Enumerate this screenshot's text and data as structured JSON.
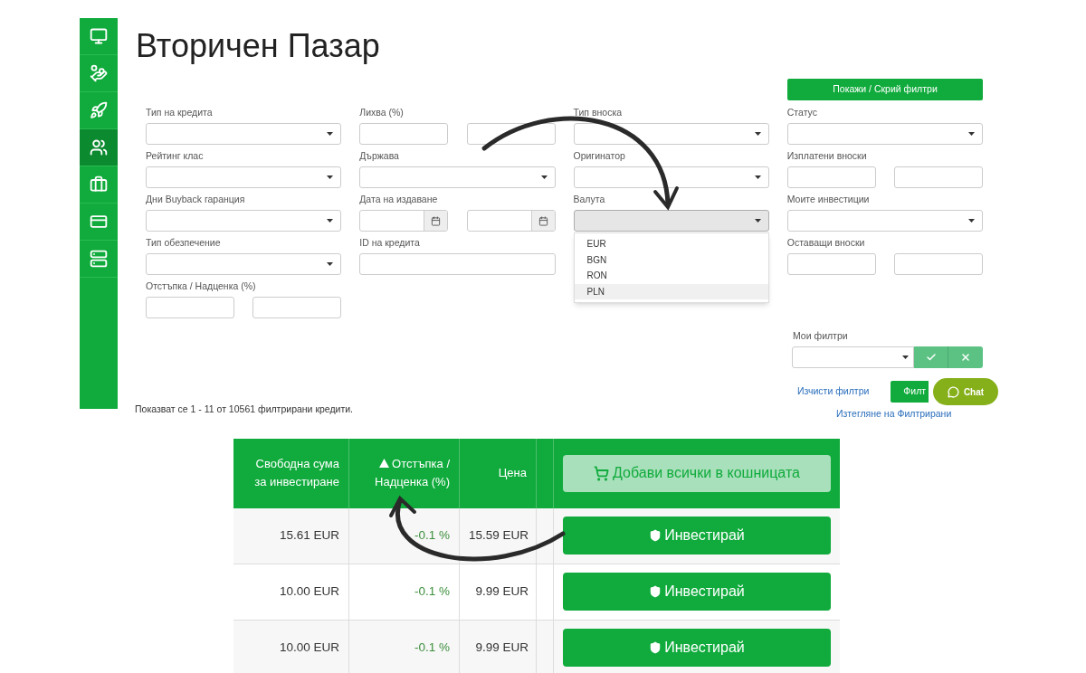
{
  "page": {
    "title": "Вторичен Пазар"
  },
  "sidebar": {
    "items": [
      {
        "selected": false
      },
      {
        "selected": false
      },
      {
        "selected": false
      },
      {
        "selected": true
      },
      {
        "selected": false
      },
      {
        "selected": false
      },
      {
        "selected": false
      }
    ]
  },
  "filters": {
    "toggle_button": "Покажи / Скрий филтри",
    "columns": [
      [
        {
          "kind": "select",
          "label": "Тип на кредита"
        },
        {
          "kind": "select",
          "label": "Рейтинг клас"
        },
        {
          "kind": "select",
          "label": "Дни Buyback гаранция"
        },
        {
          "kind": "select",
          "label": "Тип обезпечение"
        },
        {
          "kind": "range",
          "label": "Отстъпка / Надценка (%)"
        }
      ],
      [
        {
          "kind": "range",
          "label": "Лихва (%)"
        },
        {
          "kind": "select",
          "label": "Държава"
        },
        {
          "kind": "date_range",
          "label": "Дата на издаване"
        },
        {
          "kind": "input",
          "label": "ID на кредита"
        }
      ],
      [
        {
          "kind": "select",
          "label": "Тип вноска"
        },
        {
          "kind": "select",
          "label": "Оригинатор"
        },
        {
          "kind": "select",
          "label": "Валута",
          "expanded": true,
          "options": [
            {
              "label": "EUR",
              "selected": false
            },
            {
              "label": "BGN",
              "selected": false
            },
            {
              "label": "RON",
              "selected": false
            },
            {
              "label": "PLN",
              "selected": true
            }
          ]
        }
      ],
      [
        {
          "kind": "select",
          "label": "Статус"
        },
        {
          "kind": "range",
          "label": "Изплатени вноски"
        },
        {
          "kind": "select",
          "label": "Моите инвестиции"
        },
        {
          "kind": "range",
          "label": "Оставащи вноски"
        }
      ]
    ]
  },
  "my_filters": {
    "label": "Мои филтри"
  },
  "clear_link": "Изчисти филтри",
  "filter_button": "Филт",
  "download_link": "Изтегляне на Филтрирани",
  "result_text": "Показват се 1 - 11 от 10561 филтрирани кредити.",
  "chat": {
    "label": "Chat"
  },
  "table": {
    "columns": [
      {
        "label": "Свободна сума за инвестиране",
        "sorted": false
      },
      {
        "label": "Отстъпка / Надценка (%)",
        "sorted": true
      },
      {
        "label": "Цена",
        "sorted": false
      }
    ],
    "add_all_button": {
      "label": "Добави всички в кошницата",
      "disabled": true
    },
    "rows": [
      {
        "amount": "15.61 EUR",
        "discount": "-0.1 %",
        "price": "15.59 EUR",
        "action": "Инвестирай"
      },
      {
        "amount": "10.00 EUR",
        "discount": "-0.1 %",
        "price": "9.99 EUR",
        "action": "Инвестирай"
      },
      {
        "amount": "10.00 EUR",
        "discount": "-0.1 %",
        "price": "9.99 EUR",
        "action": "Инвестирай"
      }
    ]
  }
}
